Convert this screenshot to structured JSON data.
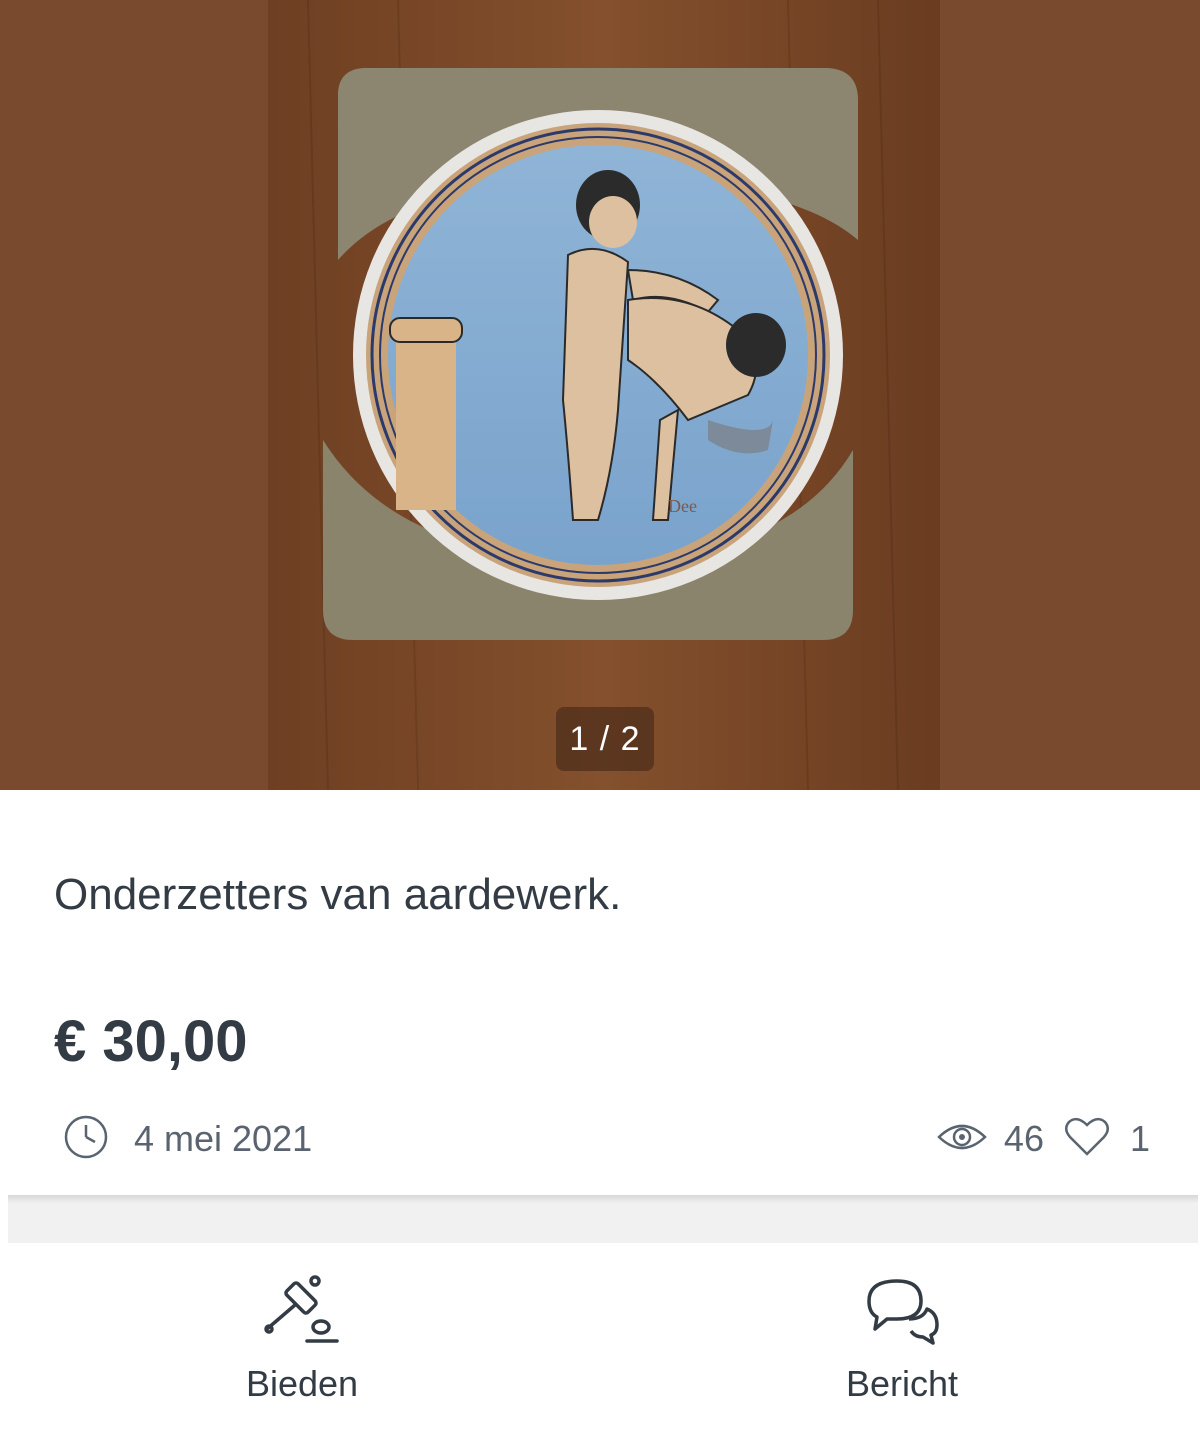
{
  "gallery": {
    "counter": "1 / 2",
    "image_alt": "Onderzetter van aardewerk",
    "signature": "Dee"
  },
  "listing": {
    "title": "Onderzetters van aardewerk.",
    "price": "€ 30,00",
    "date": "4 mei 2021",
    "views": "46",
    "likes": "1"
  },
  "actions": {
    "bid_label": "Bieden",
    "message_label": "Bericht"
  },
  "icons": {
    "date": "clock-icon",
    "views": "eye-icon",
    "likes": "heart-icon",
    "bid": "gavel-icon",
    "message": "chat-bubbles-icon"
  },
  "colors": {
    "text": "#333b45",
    "muted": "#5a6470",
    "wood": "#7a4a2e"
  }
}
